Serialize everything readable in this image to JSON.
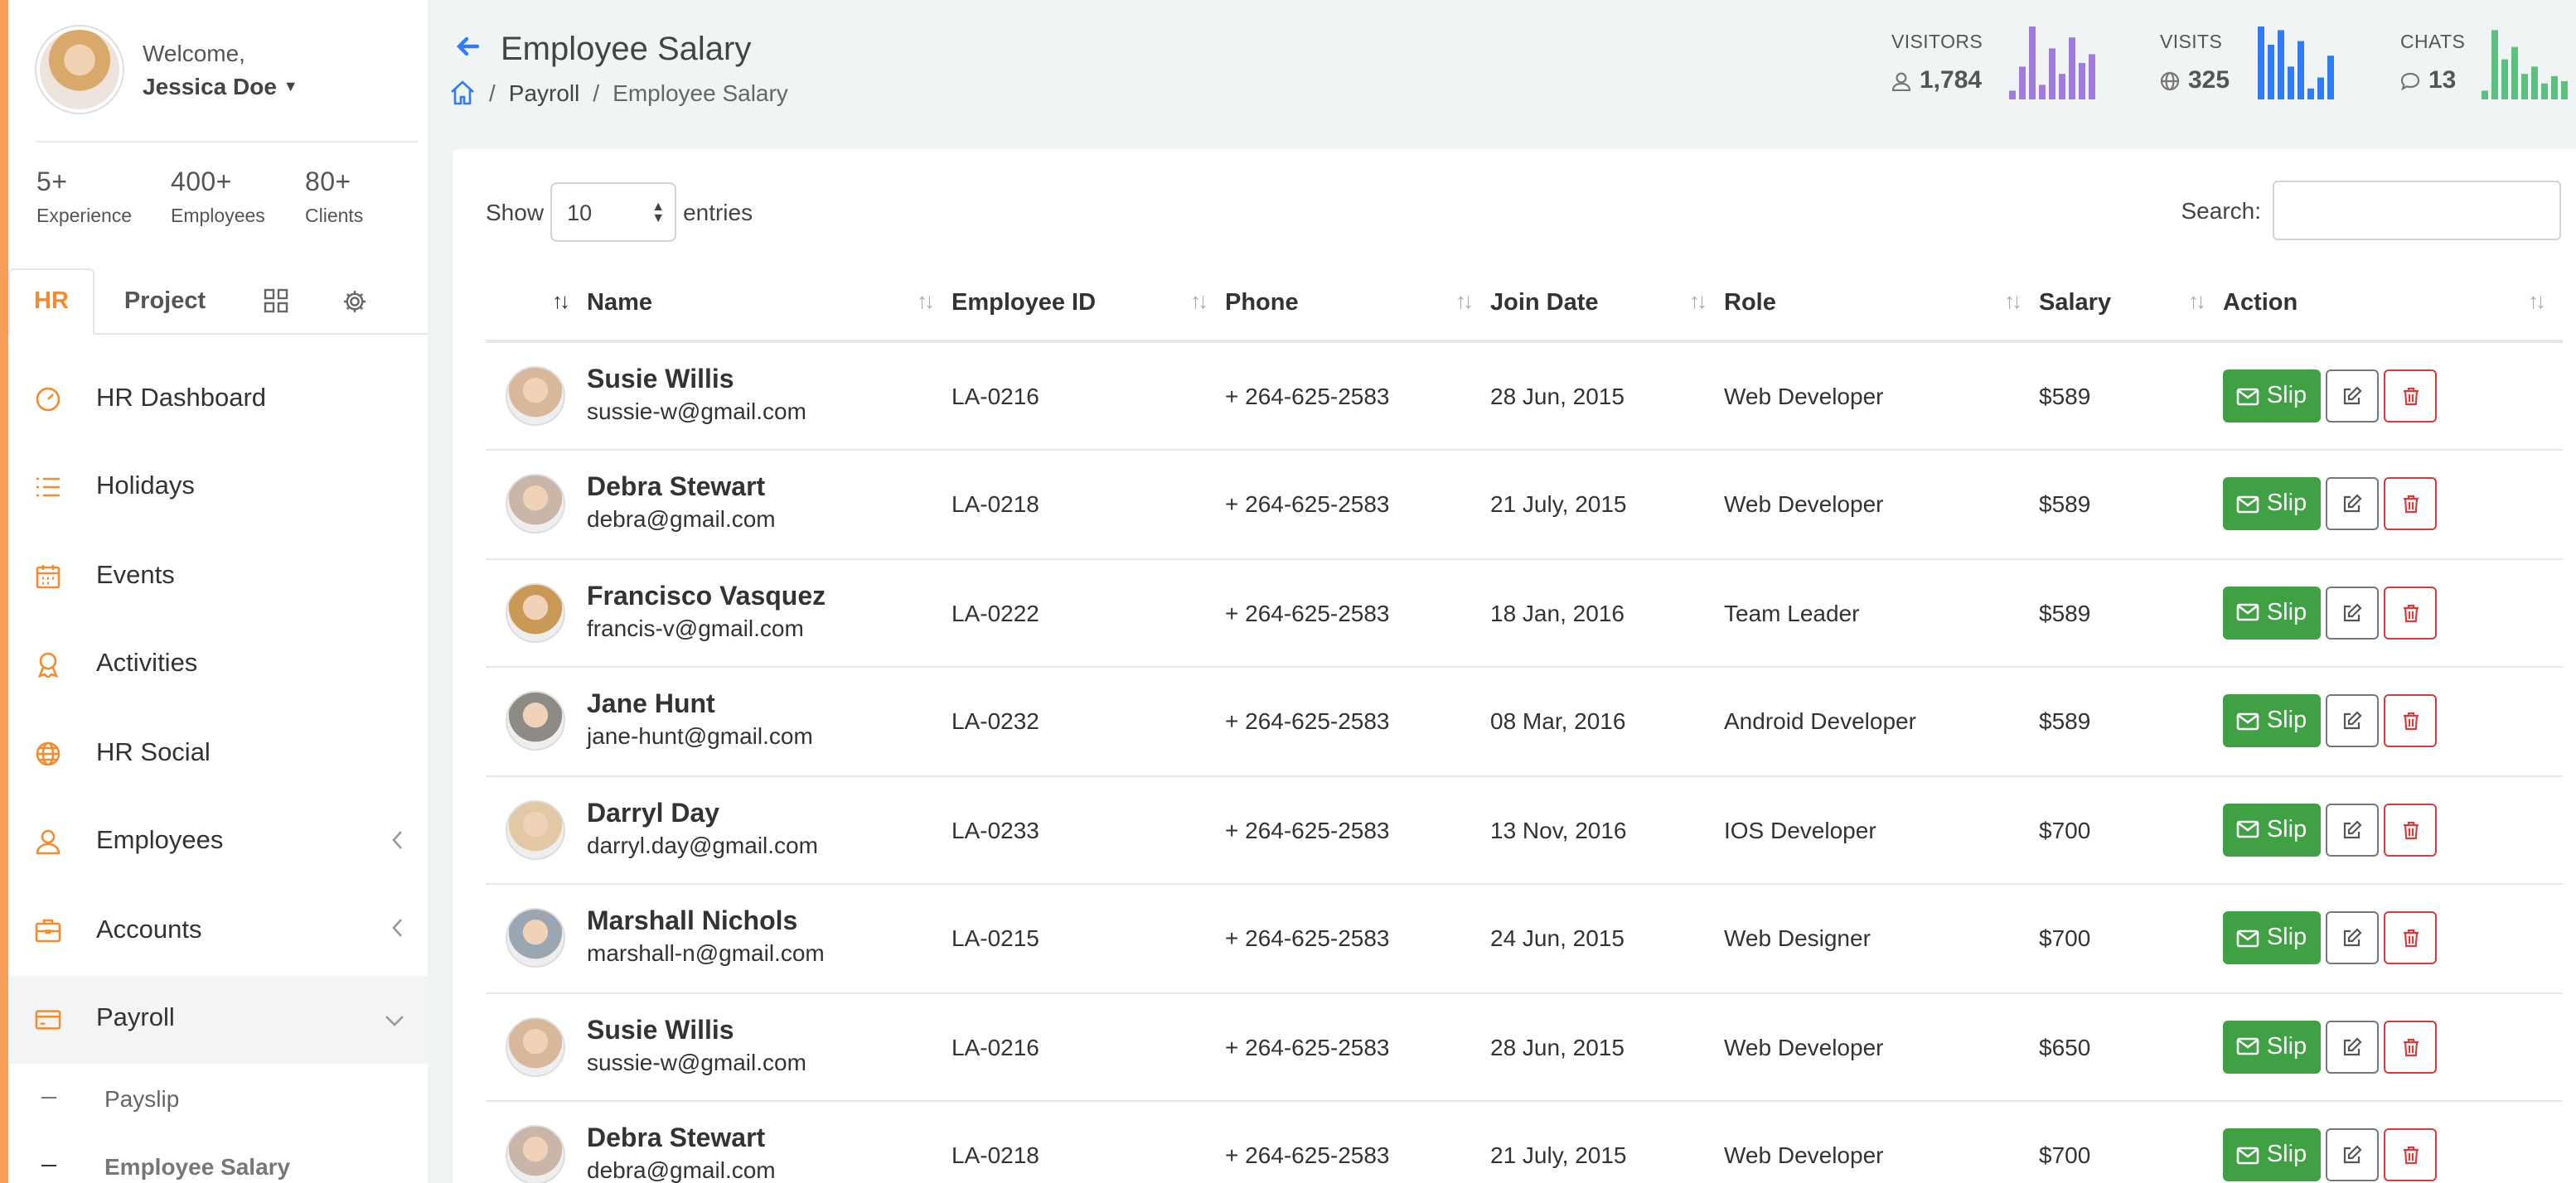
{
  "colors": {
    "accent": "#f58a2e",
    "brand_blue": "#2f7cf6",
    "success": "#3fa144",
    "danger": "#d83c3c",
    "visitors_bar": "#a17cdc",
    "visits_bar": "#2f7cf6",
    "chats_bar": "#5ac17e"
  },
  "sidebar": {
    "welcome": "Welcome,",
    "user_name": "Jessica Doe",
    "stats": [
      {
        "value": "5+",
        "label": "Experience"
      },
      {
        "value": "400+",
        "label": "Employees"
      },
      {
        "value": "80+",
        "label": "Clients"
      }
    ],
    "tabs": [
      {
        "label": "HR",
        "icon": null
      },
      {
        "label": "Project",
        "icon": null
      },
      {
        "label": "",
        "icon": "grid-icon"
      },
      {
        "label": "",
        "icon": "gear-icon"
      }
    ],
    "menu": [
      {
        "label": "HR Dashboard",
        "icon": "speedometer-icon"
      },
      {
        "label": "Holidays",
        "icon": "list-icon"
      },
      {
        "label": "Events",
        "icon": "calendar-icon"
      },
      {
        "label": "Activities",
        "icon": "badge-icon"
      },
      {
        "label": "HR Social",
        "icon": "globe-icon"
      },
      {
        "label": "Employees",
        "icon": "users-icon",
        "chevron": "left"
      },
      {
        "label": "Accounts",
        "icon": "briefcase-icon",
        "chevron": "left"
      },
      {
        "label": "Payroll",
        "icon": "credit-card-icon",
        "chevron": "down"
      }
    ],
    "submenu": [
      {
        "label": "Payslip"
      },
      {
        "label": "Employee Salary"
      }
    ]
  },
  "header": {
    "title": "Employee Salary",
    "breadcrumb": [
      "Payroll",
      "Employee Salary"
    ],
    "separator": "/",
    "stats": [
      {
        "label": "VISITORS",
        "value": "1,784",
        "icon": "user-icon",
        "bars": [
          0.12,
          0.45,
          1.0,
          0.2,
          0.7,
          0.35,
          0.85,
          0.5,
          0.62
        ]
      },
      {
        "label": "VISITS",
        "value": "325",
        "icon": "globe-icon",
        "bars": [
          1.0,
          0.75,
          0.95,
          0.45,
          0.8,
          0.15,
          0.3,
          0.6
        ]
      },
      {
        "label": "CHATS",
        "value": "13",
        "icon": "chat-icon",
        "bars": [
          0.12,
          0.95,
          0.55,
          0.72,
          0.35,
          0.45,
          0.22,
          0.32,
          0.25
        ]
      }
    ]
  },
  "table_controls": {
    "show_label": "Show",
    "entries_value": "10",
    "entries_label": "entries",
    "search_label": "Search:",
    "search_value": ""
  },
  "table": {
    "columns": [
      "",
      "Name",
      "Employee ID",
      "Phone",
      "Join Date",
      "Role",
      "Salary",
      "Action"
    ],
    "slip_label": "Slip",
    "rows": [
      {
        "name": "Susie Willis",
        "email": "sussie-w@gmail.com",
        "id": "LA-0216",
        "phone": "+ 264-625-2583",
        "join": "28 Jun, 2015",
        "role": "Web Developer",
        "salary": "$589",
        "av": "#d9b79a"
      },
      {
        "name": "Debra Stewart",
        "email": "debra@gmail.com",
        "id": "LA-0218",
        "phone": "+ 264-625-2583",
        "join": "21 July, 2015",
        "role": "Web Developer",
        "salary": "$589",
        "av": "#c9b6a8"
      },
      {
        "name": "Francisco Vasquez",
        "email": "francis-v@gmail.com",
        "id": "LA-0222",
        "phone": "+ 264-625-2583",
        "join": "18 Jan, 2016",
        "role": "Team Leader",
        "salary": "$589",
        "av": "#c99a55"
      },
      {
        "name": "Jane Hunt",
        "email": "jane-hunt@gmail.com",
        "id": "LA-0232",
        "phone": "+ 264-625-2583",
        "join": "08 Mar, 2016",
        "role": "Android Developer",
        "salary": "$589",
        "av": "#8e8a86"
      },
      {
        "name": "Darryl Day",
        "email": "darryl.day@gmail.com",
        "id": "LA-0233",
        "phone": "+ 264-625-2583",
        "join": "13 Nov, 2016",
        "role": "IOS Developer",
        "salary": "$700",
        "av": "#e3c8a6"
      },
      {
        "name": "Marshall Nichols",
        "email": "marshall-n@gmail.com",
        "id": "LA-0215",
        "phone": "+ 264-625-2583",
        "join": "24 Jun, 2015",
        "role": "Web Designer",
        "salary": "$700",
        "av": "#9aa6b2"
      },
      {
        "name": "Susie Willis",
        "email": "sussie-w@gmail.com",
        "id": "LA-0216",
        "phone": "+ 264-625-2583",
        "join": "28 Jun, 2015",
        "role": "Web Developer",
        "salary": "$650",
        "av": "#d9b79a"
      },
      {
        "name": "Debra Stewart",
        "email": "debra@gmail.com",
        "id": "LA-0218",
        "phone": "+ 264-625-2583",
        "join": "21 July, 2015",
        "role": "Web Developer",
        "salary": "$700",
        "av": "#c9b6a8"
      }
    ]
  }
}
